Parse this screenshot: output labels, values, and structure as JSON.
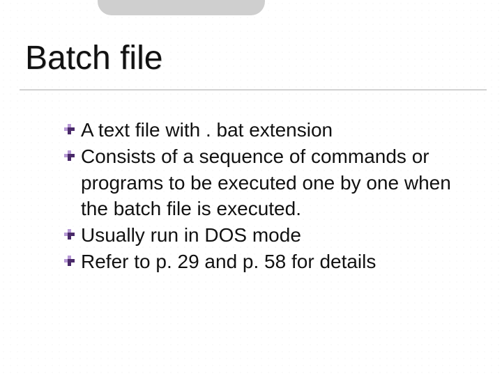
{
  "title": "Batch file",
  "bullets": [
    "A text file with . bat extension",
    "Consists of a sequence of commands or programs to be executed one by one when the batch file is executed.",
    "Usually run in DOS mode",
    "Refer to p. 29 and p. 58 for details"
  ]
}
